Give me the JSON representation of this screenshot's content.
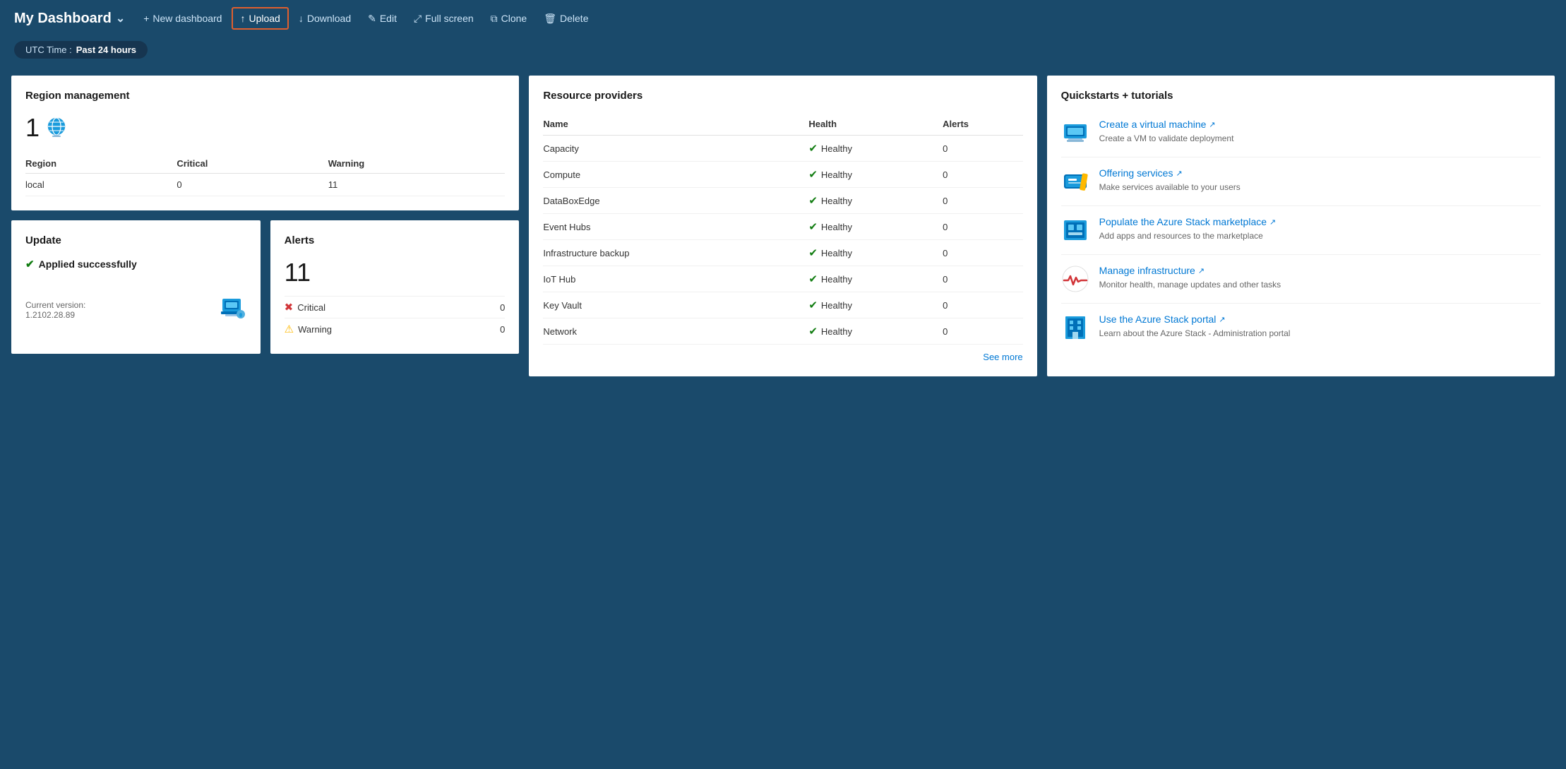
{
  "topbar": {
    "title": "My Dashboard",
    "chevron": "∨",
    "buttons": [
      {
        "id": "new-dashboard",
        "icon": "+",
        "label": "New dashboard"
      },
      {
        "id": "upload",
        "icon": "↑",
        "label": "Upload",
        "highlighted": true
      },
      {
        "id": "download",
        "icon": "↓",
        "label": "Download"
      },
      {
        "id": "edit",
        "icon": "✎",
        "label": "Edit"
      },
      {
        "id": "fullscreen",
        "icon": "⤢",
        "label": "Full screen"
      },
      {
        "id": "clone",
        "icon": "⧉",
        "label": "Clone"
      },
      {
        "id": "delete",
        "icon": "🗑",
        "label": "Delete"
      }
    ]
  },
  "timebar": {
    "label": "UTC Time :",
    "value": "Past 24 hours"
  },
  "region_management": {
    "title": "Region management",
    "count": "1",
    "table": {
      "headers": [
        "Region",
        "Critical",
        "Warning"
      ],
      "rows": [
        {
          "region": "local",
          "critical": "0",
          "warning": "11"
        }
      ]
    }
  },
  "update": {
    "title": "Update",
    "status": "Applied successfully",
    "version_label": "Current version:",
    "version": "1.2102.28.89"
  },
  "alerts": {
    "title": "Alerts",
    "count": "11",
    "rows": [
      {
        "icon": "critical",
        "label": "Critical",
        "count": "0"
      },
      {
        "icon": "warning",
        "label": "Warning",
        "count": "0"
      }
    ]
  },
  "resource_providers": {
    "title": "Resource providers",
    "headers": [
      "Name",
      "Health",
      "Alerts"
    ],
    "rows": [
      {
        "name": "Capacity",
        "health": "Healthy",
        "alerts": "0"
      },
      {
        "name": "Compute",
        "health": "Healthy",
        "alerts": "0"
      },
      {
        "name": "DataBoxEdge",
        "health": "Healthy",
        "alerts": "0"
      },
      {
        "name": "Event Hubs",
        "health": "Healthy",
        "alerts": "0"
      },
      {
        "name": "Infrastructure backup",
        "health": "Healthy",
        "alerts": "0"
      },
      {
        "name": "IoT Hub",
        "health": "Healthy",
        "alerts": "0"
      },
      {
        "name": "Key Vault",
        "health": "Healthy",
        "alerts": "0"
      },
      {
        "name": "Network",
        "health": "Healthy",
        "alerts": "0"
      }
    ],
    "see_more": "See more"
  },
  "quickstarts": {
    "title": "Quickstarts + tutorials",
    "items": [
      {
        "id": "create-vm",
        "icon": "vm",
        "link": "Create a virtual machine",
        "desc": "Create a VM to validate deployment"
      },
      {
        "id": "offering-services",
        "icon": "ticket",
        "link": "Offering services",
        "desc": "Make services available to your users"
      },
      {
        "id": "marketplace",
        "icon": "marketplace",
        "link": "Populate the Azure Stack marketplace",
        "desc": "Add apps and resources to the marketplace"
      },
      {
        "id": "manage-infra",
        "icon": "heartbeat",
        "link": "Manage infrastructure",
        "desc": "Monitor health, manage updates and other tasks"
      },
      {
        "id": "azure-portal",
        "icon": "building",
        "link": "Use the Azure Stack portal",
        "desc": "Learn about the Azure Stack - Administration portal"
      }
    ]
  }
}
